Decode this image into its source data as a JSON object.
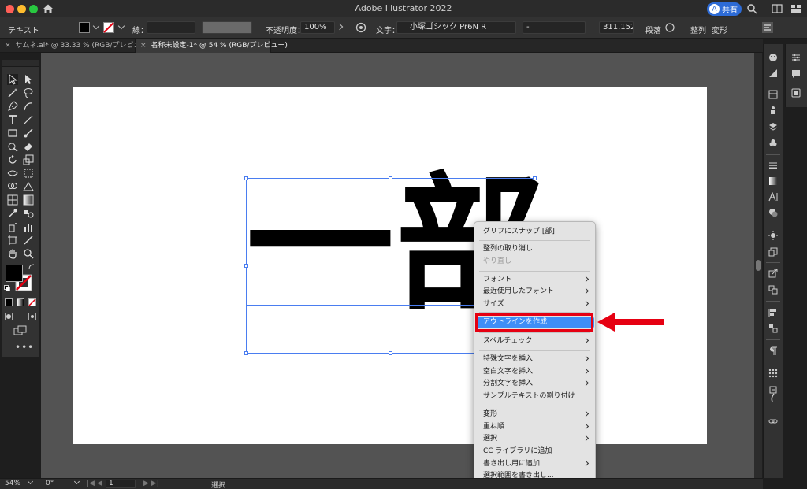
{
  "window": {
    "title": "Adobe Illustrator 2022",
    "share_label": "共有",
    "share_avatar": "A"
  },
  "control_bar": {
    "mode_label": "テキスト",
    "stroke_label": "線：",
    "opacity_label": "不透明度：",
    "opacity_value": "100%",
    "char_label": "文字：",
    "font_name": "小塚ゴシック Pr6N R",
    "font_style": "-",
    "font_size": "311.152",
    "paragraph_label": "段落",
    "align_label": "整列",
    "transform_label": "変形"
  },
  "tabs": [
    {
      "label": "サムネ.ai* @ 33.33 % (RGB/プレビュー)",
      "active": false
    },
    {
      "label": "名称未設定-1* @ 54 % (RGB/プレビュー)",
      "active": true
    }
  ],
  "artboard": {
    "text": "一部"
  },
  "context_menu": {
    "items": [
      {
        "label": "グリフにスナップ [部]",
        "submenu": false,
        "disabled": false
      },
      {
        "label": "整列の取り消し",
        "submenu": false,
        "disabled": false
      },
      {
        "label": "やり直し",
        "submenu": false,
        "disabled": true
      },
      {
        "label": "フォント",
        "submenu": true,
        "disabled": false
      },
      {
        "label": "最近使用したフォント",
        "submenu": true,
        "disabled": false
      },
      {
        "label": "サイズ",
        "submenu": true,
        "disabled": false
      },
      {
        "label": "アウトラインを作成",
        "submenu": false,
        "disabled": false,
        "highlighted": true
      },
      {
        "label": "スペルチェック",
        "submenu": true,
        "disabled": false
      },
      {
        "label": "特殊文字を挿入",
        "submenu": true,
        "disabled": false
      },
      {
        "label": "空白文字を挿入",
        "submenu": true,
        "disabled": false
      },
      {
        "label": "分割文字を挿入",
        "submenu": true,
        "disabled": false
      },
      {
        "label": "サンプルテキストの割り付け",
        "submenu": false,
        "disabled": false
      },
      {
        "label": "変形",
        "submenu": true,
        "disabled": false
      },
      {
        "label": "重ね順",
        "submenu": true,
        "disabled": false
      },
      {
        "label": "選択",
        "submenu": true,
        "disabled": false
      },
      {
        "label": "CC ライブラリに追加",
        "submenu": false,
        "disabled": false
      },
      {
        "label": "書き出し用に追加",
        "submenu": true,
        "disabled": false
      },
      {
        "label": "選択範囲を書き出し...",
        "submenu": false,
        "disabled": false
      }
    ]
  },
  "status_bar": {
    "zoom": "54%",
    "rotation": "0°",
    "artboard_num": "1",
    "tool_label": "選択"
  },
  "colors": {
    "accent": "#3f8ef7",
    "annotation_red": "#e60012",
    "selection_blue": "#4a7df0"
  }
}
